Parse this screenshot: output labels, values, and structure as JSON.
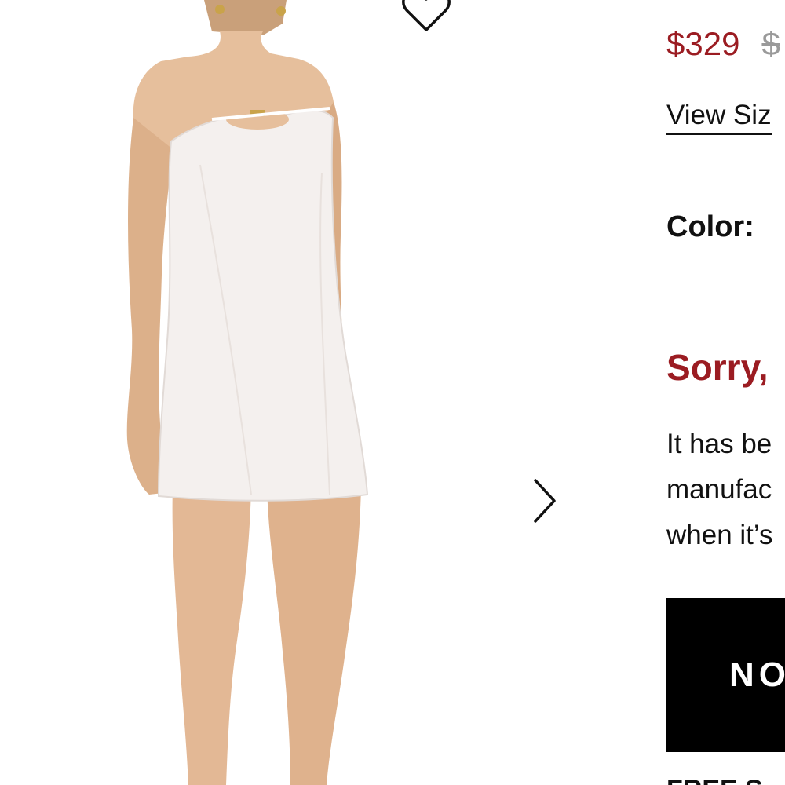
{
  "product": {
    "price": "$329",
    "original_price": "$",
    "image_alt": "White strapless mini dress with cutout detail"
  },
  "links": {
    "size_guide": "View Siz"
  },
  "color": {
    "label": "Color:"
  },
  "availability": {
    "title": "Sorry,",
    "message_lines": [
      "It has be",
      "manufac",
      "when it’s"
    ]
  },
  "buttons": {
    "notify": "NO"
  },
  "shipping": {
    "label": "FREE S"
  },
  "icons": {
    "wishlist": "heart-outline-icon",
    "next": "chevron-right-icon"
  },
  "colors": {
    "accent_red": "#9b1c22",
    "button_black": "#000000"
  }
}
